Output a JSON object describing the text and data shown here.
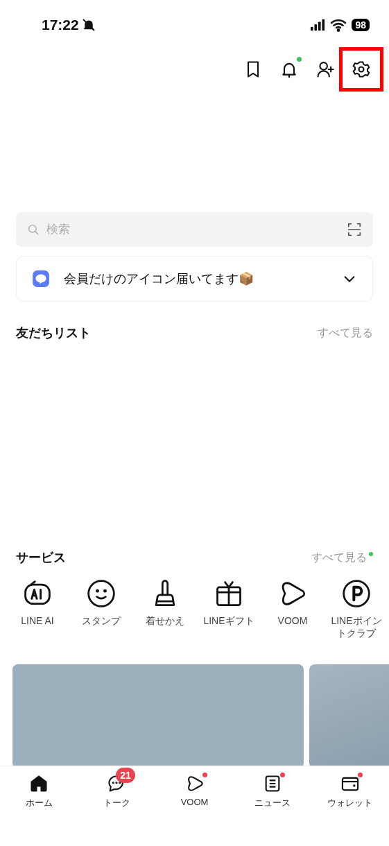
{
  "status_bar": {
    "time": "17:22",
    "silent": true,
    "battery": "98"
  },
  "header_icons": [
    {
      "kind": "bookmark",
      "dot": false,
      "highlighted": false
    },
    {
      "kind": "bell",
      "dot": true,
      "highlighted": false
    },
    {
      "kind": "add-friend",
      "dot": false,
      "highlighted": false
    },
    {
      "kind": "settings",
      "dot": false,
      "highlighted": true
    }
  ],
  "search": {
    "placeholder": "検索"
  },
  "banner": {
    "text": "会員だけのアイコン届いてます📦"
  },
  "friends": {
    "title": "友だちリスト",
    "link": "すべて見る"
  },
  "services": {
    "title": "サービス",
    "link": "すべて見る",
    "link_dot": true,
    "items": [
      {
        "kind": "ai",
        "label": "LINE AI"
      },
      {
        "kind": "sticker",
        "label": "スタンプ"
      },
      {
        "kind": "theme",
        "label": "着せかえ"
      },
      {
        "kind": "gift",
        "label": "LINEギフト"
      },
      {
        "kind": "voom",
        "label": "VOOM"
      },
      {
        "kind": "points",
        "label": "LINEポイントクラブ"
      }
    ]
  },
  "tabs": [
    {
      "kind": "home",
      "label": "ホーム",
      "selected": true
    },
    {
      "kind": "talk",
      "label": "トーク",
      "selected": false,
      "badge": "21"
    },
    {
      "kind": "voom",
      "label": "VOOM",
      "selected": false,
      "dot": true
    },
    {
      "kind": "news",
      "label": "ニュース",
      "selected": false,
      "dot": true
    },
    {
      "kind": "wallet",
      "label": "ウォレット",
      "selected": false,
      "dot": true
    }
  ]
}
